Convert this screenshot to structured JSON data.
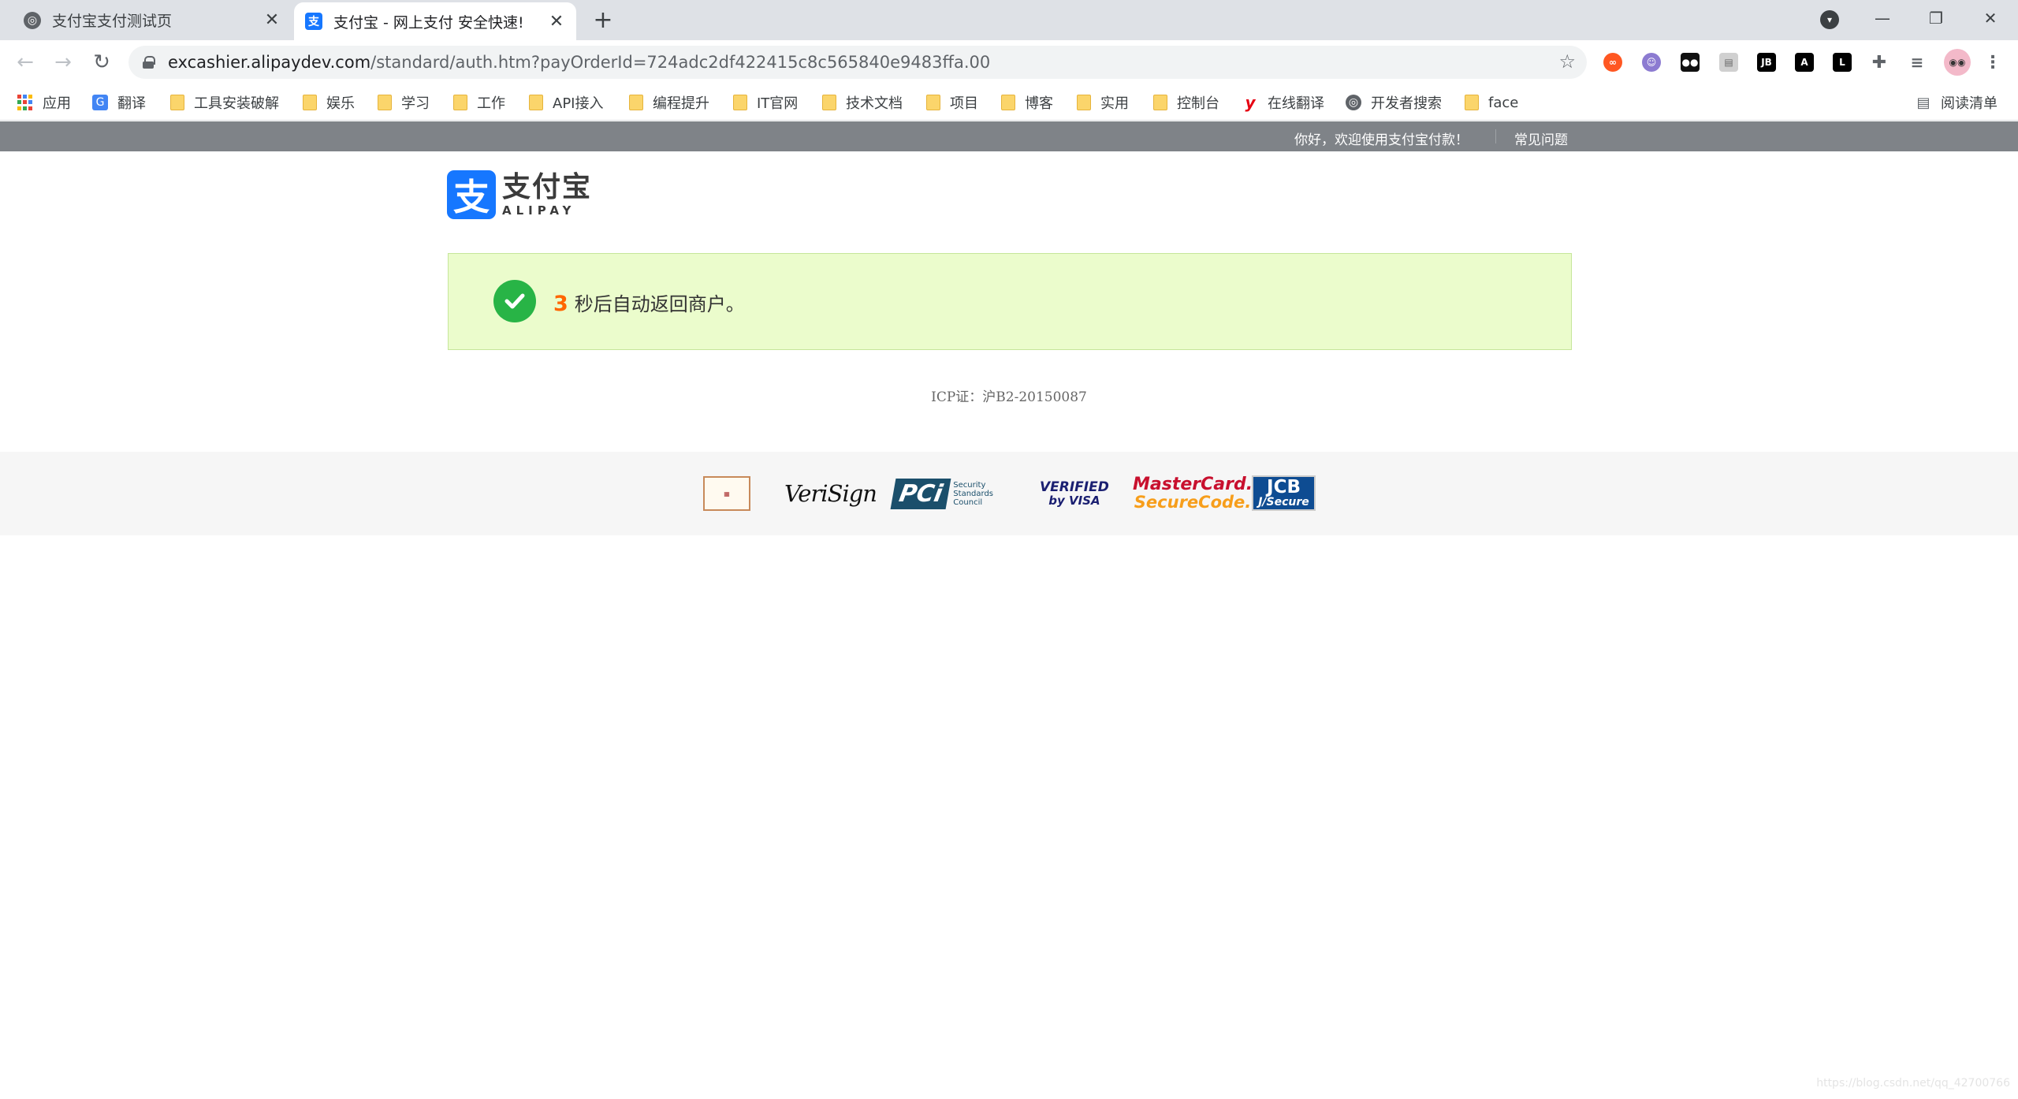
{
  "browser": {
    "tabs": [
      {
        "title": "支付宝支付测试页",
        "active": false,
        "favicon": "globe-icon"
      },
      {
        "title": "支付宝 - 网上支付 安全快速!",
        "active": true,
        "favicon": "alipay-icon"
      }
    ],
    "new_tab_label": "+",
    "url_host": "excashier.alipaydev.com",
    "url_path": "/standard/auth.htm?payOrderId=724adc2df422415c8c565840e9483ffa.00",
    "bookmarks": [
      {
        "label": "应用",
        "icon": "apps-icon"
      },
      {
        "label": "翻译",
        "icon": "translate-icon"
      },
      {
        "label": "工具安装破解",
        "icon": "folder-icon"
      },
      {
        "label": "娱乐",
        "icon": "folder-icon"
      },
      {
        "label": "学习",
        "icon": "folder-icon"
      },
      {
        "label": "工作",
        "icon": "folder-icon"
      },
      {
        "label": "API接入",
        "icon": "folder-icon"
      },
      {
        "label": "编程提升",
        "icon": "folder-icon"
      },
      {
        "label": "IT官网",
        "icon": "folder-icon"
      },
      {
        "label": "技术文档",
        "icon": "folder-icon"
      },
      {
        "label": "项目",
        "icon": "folder-icon"
      },
      {
        "label": "博客",
        "icon": "folder-icon"
      },
      {
        "label": "实用",
        "icon": "folder-icon"
      },
      {
        "label": "控制台",
        "icon": "folder-icon"
      },
      {
        "label": "在线翻译",
        "icon": "youdao-icon"
      },
      {
        "label": "开发者搜索",
        "icon": "globe-icon"
      },
      {
        "label": "face",
        "icon": "folder-icon"
      }
    ],
    "reading_list_label": "阅读清单"
  },
  "page": {
    "welcome_text": "你好，欢迎使用支付宝付款！",
    "faq_link": "常见问题",
    "logo": {
      "mark": "支",
      "cn": "支付宝",
      "en": "ALIPAY"
    },
    "success": {
      "countdown": "3",
      "message": "秒后自动返回商户。"
    },
    "icp": "ICP证：沪B2-20150087",
    "badges": {
      "verisign": "VeriSign",
      "pci": "PCi",
      "pci_sub": "Security Standards Council",
      "visa_line1": "VERIFIED",
      "visa_line2": "by VISA",
      "mastercard_line1": "MasterCard.",
      "mastercard_line2": "SecureCode.",
      "jcb_line1": "JCB",
      "jcb_line2": "J/Secure"
    },
    "watermark": "https://blog.csdn.net/qq_42700766"
  },
  "colors": {
    "alipay_blue": "#1677ff",
    "success_bg": "#ebfccc",
    "countdown": "#ff6600",
    "check_green": "#28b446",
    "top_strip": "#7f8388"
  }
}
